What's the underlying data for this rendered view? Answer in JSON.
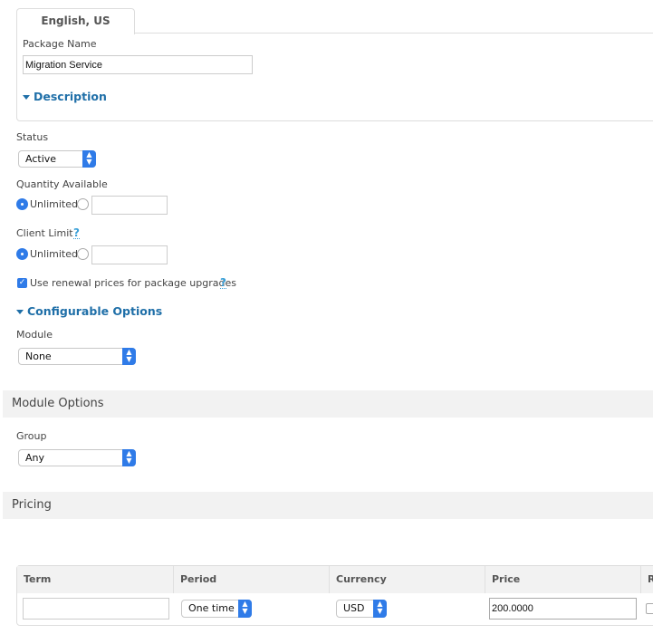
{
  "language_tab": "English, US",
  "package_name": {
    "label": "Package Name",
    "value": "Migration Service"
  },
  "description_toggle": "Description",
  "status": {
    "label": "Status",
    "value": "Active"
  },
  "quantity": {
    "label": "Quantity Available",
    "unlimited_label": "Unlimited",
    "selected": "unlimited",
    "value": ""
  },
  "client_limit": {
    "label": "Client Limit",
    "help": "?",
    "unlimited_label": "Unlimited",
    "selected": "unlimited",
    "value": ""
  },
  "renewal": {
    "label": "Use renewal prices for package upgrades",
    "checked": true,
    "help": "?"
  },
  "configurable_options": "Configurable Options",
  "module": {
    "label": "Module",
    "value": "None"
  },
  "module_options": {
    "title": "Module Options",
    "group_label": "Group",
    "group_value": "Any"
  },
  "pricing": {
    "title": "Pricing",
    "columns": [
      "Term",
      "Period",
      "Currency",
      "Price",
      "R"
    ],
    "rows": [
      {
        "term": "",
        "period": "One time",
        "currency": "USD",
        "price": "200.0000",
        "checked": false
      }
    ]
  },
  "colors": {
    "accent": "#2f7be8",
    "link": "#1f6fa8",
    "bar": "#f2f2f2"
  }
}
